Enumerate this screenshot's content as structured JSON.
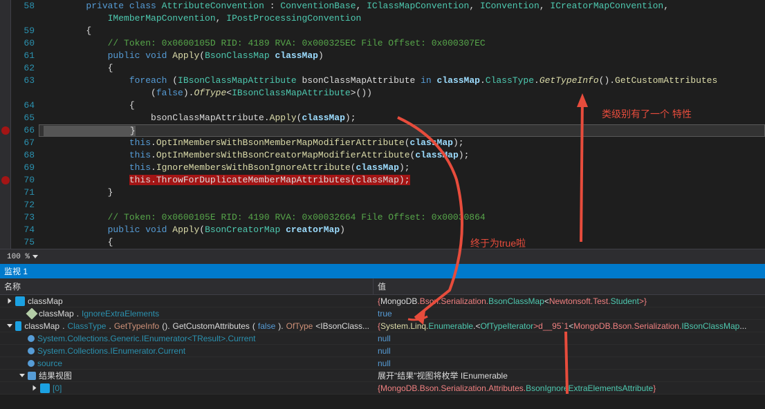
{
  "code": {
    "lines": [
      {
        "num": 58,
        "tokens": [
          {
            "t": "        ",
            "c": ""
          },
          {
            "t": "private class",
            "c": "kw"
          },
          {
            "t": " ",
            "c": ""
          },
          {
            "t": "AttributeConvention",
            "c": "type"
          },
          {
            "t": " : ",
            "c": ""
          },
          {
            "t": "ConventionBase",
            "c": "type"
          },
          {
            "t": ", ",
            "c": ""
          },
          {
            "t": "IClassMapConvention",
            "c": "type"
          },
          {
            "t": ", ",
            "c": ""
          },
          {
            "t": "IConvention",
            "c": "type"
          },
          {
            "t": ", ",
            "c": ""
          },
          {
            "t": "ICreatorMapConvention",
            "c": "type"
          },
          {
            "t": ",",
            "c": ""
          }
        ]
      },
      {
        "num": null,
        "tokens": [
          {
            "t": "            ",
            "c": ""
          },
          {
            "t": "IMemberMapConvention",
            "c": "type"
          },
          {
            "t": ", ",
            "c": ""
          },
          {
            "t": "IPostProcessingConvention",
            "c": "type"
          }
        ]
      },
      {
        "num": 59,
        "tokens": [
          {
            "t": "        {",
            "c": ""
          }
        ]
      },
      {
        "num": 60,
        "tokens": [
          {
            "t": "            ",
            "c": ""
          },
          {
            "t": "// Token: 0x0600105D RID: 4189 RVA: 0x000325EC File Offset: 0x000307EC",
            "c": "comment"
          }
        ]
      },
      {
        "num": 61,
        "tokens": [
          {
            "t": "            ",
            "c": ""
          },
          {
            "t": "public void",
            "c": "kw"
          },
          {
            "t": " ",
            "c": ""
          },
          {
            "t": "Apply",
            "c": "method"
          },
          {
            "t": "(",
            "c": ""
          },
          {
            "t": "BsonClassMap",
            "c": "type"
          },
          {
            "t": " ",
            "c": ""
          },
          {
            "t": "classMap",
            "c": "param"
          },
          {
            "t": ")",
            "c": ""
          }
        ]
      },
      {
        "num": 62,
        "tokens": [
          {
            "t": "            {",
            "c": ""
          }
        ]
      },
      {
        "num": 63,
        "tokens": [
          {
            "t": "                ",
            "c": ""
          },
          {
            "t": "foreach",
            "c": "kw"
          },
          {
            "t": " (",
            "c": ""
          },
          {
            "t": "IBsonClassMapAttribute",
            "c": "type"
          },
          {
            "t": " bsonClassMapAttribute ",
            "c": ""
          },
          {
            "t": "in",
            "c": "kw"
          },
          {
            "t": " ",
            "c": ""
          },
          {
            "t": "classMap",
            "c": "param"
          },
          {
            "t": ".",
            "c": ""
          },
          {
            "t": "ClassType",
            "c": "type"
          },
          {
            "t": ".",
            "c": ""
          },
          {
            "t": "GetTypeInfo",
            "c": "method-it"
          },
          {
            "t": "().",
            "c": ""
          },
          {
            "t": "GetCustomAttributes",
            "c": "method"
          }
        ]
      },
      {
        "num": null,
        "tokens": [
          {
            "t": "                    (",
            "c": ""
          },
          {
            "t": "false",
            "c": "kw"
          },
          {
            "t": ").",
            "c": ""
          },
          {
            "t": "OfType",
            "c": "method-it"
          },
          {
            "t": "<",
            "c": ""
          },
          {
            "t": "IBsonClassMapAttribute",
            "c": "type"
          },
          {
            "t": ">())",
            "c": ""
          }
        ]
      },
      {
        "num": 64,
        "tokens": [
          {
            "t": "                {",
            "c": ""
          }
        ]
      },
      {
        "num": 65,
        "tokens": [
          {
            "t": "                    bsonClassMapAttribute.",
            "c": ""
          },
          {
            "t": "Apply",
            "c": "method"
          },
          {
            "t": "(",
            "c": ""
          },
          {
            "t": "classMap",
            "c": "param"
          },
          {
            "t": ");",
            "c": ""
          }
        ]
      },
      {
        "num": 66,
        "bp": true,
        "current": true,
        "tokens": [
          {
            "t": "                }",
            "c": "highlight-cur"
          }
        ]
      },
      {
        "num": 67,
        "tokens": [
          {
            "t": "                ",
            "c": ""
          },
          {
            "t": "this",
            "c": "this"
          },
          {
            "t": ".",
            "c": ""
          },
          {
            "t": "OptInMembersWithBsonMemberMapModifierAttribute",
            "c": "method"
          },
          {
            "t": "(",
            "c": ""
          },
          {
            "t": "cl",
            "c": "param"
          },
          {
            "t": "a",
            "c": "param"
          },
          {
            "t": "ssMap",
            "c": "param"
          },
          {
            "t": ");",
            "c": ""
          }
        ]
      },
      {
        "num": 68,
        "tokens": [
          {
            "t": "                ",
            "c": ""
          },
          {
            "t": "this",
            "c": "this"
          },
          {
            "t": ".",
            "c": ""
          },
          {
            "t": "OptInMembersWithBsonCreatorMapModifierAttribute",
            "c": "method"
          },
          {
            "t": "(",
            "c": ""
          },
          {
            "t": "cl",
            "c": "param"
          },
          {
            "t": "a",
            "c": "param"
          },
          {
            "t": "ssMap",
            "c": "param"
          },
          {
            "t": ");",
            "c": ""
          }
        ]
      },
      {
        "num": 69,
        "tokens": [
          {
            "t": "                ",
            "c": ""
          },
          {
            "t": "this",
            "c": "this"
          },
          {
            "t": ".",
            "c": ""
          },
          {
            "t": "IgnoreMembersWithBsonIgnoreAttribute",
            "c": "method"
          },
          {
            "t": "(",
            "c": ""
          },
          {
            "t": "classMap",
            "c": "param"
          },
          {
            "t": ");",
            "c": ""
          }
        ]
      },
      {
        "num": 70,
        "bp": true,
        "tokens": [
          {
            "t": "                ",
            "c": ""
          },
          {
            "t": "this.ThrowForDuplicateMemberMapAttributes(classMap);",
            "c": "highlight-err"
          }
        ]
      },
      {
        "num": 71,
        "tokens": [
          {
            "t": "            }",
            "c": ""
          }
        ]
      },
      {
        "num": 72,
        "tokens": [
          {
            "t": "",
            "c": ""
          }
        ]
      },
      {
        "num": 73,
        "tokens": [
          {
            "t": "            ",
            "c": ""
          },
          {
            "t": "// Token: 0x0600105E RID: 4190 RVA: 0x00032664 File Offset: 0x00030864",
            "c": "comment"
          }
        ]
      },
      {
        "num": 74,
        "tokens": [
          {
            "t": "            ",
            "c": ""
          },
          {
            "t": "public void",
            "c": "kw"
          },
          {
            "t": " ",
            "c": ""
          },
          {
            "t": "Apply",
            "c": "method"
          },
          {
            "t": "(",
            "c": ""
          },
          {
            "t": "BsonCreatorMap",
            "c": "type"
          },
          {
            "t": " ",
            "c": ""
          },
          {
            "t": "creatorMap",
            "c": "param"
          },
          {
            "t": ")",
            "c": ""
          }
        ]
      },
      {
        "num": 75,
        "tokens": [
          {
            "t": "            {",
            "c": ""
          }
        ]
      }
    ]
  },
  "zoom": "100 %",
  "watch": {
    "title": "监视 1",
    "headers": {
      "name": "名称",
      "value": "值"
    },
    "rows": [
      {
        "indent": 0,
        "expand": "closed",
        "icon": "var",
        "name_parts": [
          {
            "t": "classMap",
            "c": "t-white"
          }
        ],
        "value_parts": [
          {
            "t": "{",
            "c": "t-red"
          },
          {
            "t": "MongoDB",
            "c": "t-white"
          },
          {
            "t": ".Bson.Serialization.",
            "c": "t-red"
          },
          {
            "t": "BsonClassMap",
            "c": "t-cyan"
          },
          {
            "t": "<",
            "c": "t-white"
          },
          {
            "t": "Newtonsoft.Test.",
            "c": "t-red"
          },
          {
            "t": "Student",
            "c": "t-cyan"
          },
          {
            "t": ">}",
            "c": "t-red"
          }
        ]
      },
      {
        "indent": 1,
        "expand": "none",
        "icon": "prop",
        "name_parts": [
          {
            "t": "classMap",
            "c": "t-white"
          },
          {
            "t": ".",
            "c": "t-white"
          },
          {
            "t": "IgnoreExtraElements",
            "c": "t-teal"
          }
        ],
        "value_parts": [
          {
            "t": "true",
            "c": "t-blue"
          }
        ]
      },
      {
        "indent": 0,
        "expand": "open",
        "icon": "var",
        "name_parts": [
          {
            "t": "classMap",
            "c": "t-white"
          },
          {
            "t": ".",
            "c": "t-white"
          },
          {
            "t": "ClassType",
            "c": "t-teal"
          },
          {
            "t": ".",
            "c": "t-white"
          },
          {
            "t": "GetTypeInfo",
            "c": "t-orange"
          },
          {
            "t": "().",
            "c": "t-white"
          },
          {
            "t": "GetCustomAttributes",
            "c": "t-white"
          },
          {
            "t": "(",
            "c": "t-white"
          },
          {
            "t": "false",
            "c": "t-blue"
          },
          {
            "t": ").",
            "c": "t-white"
          },
          {
            "t": "OfType",
            "c": "t-orange"
          },
          {
            "t": "<IBsonClass...",
            "c": "t-white"
          }
        ],
        "value_parts": [
          {
            "t": "{",
            "c": "t-red"
          },
          {
            "t": "System.Linq.",
            "c": "t-yellow"
          },
          {
            "t": "Enumerable",
            "c": "t-cyan"
          },
          {
            "t": ".<",
            "c": "t-white"
          },
          {
            "t": "OfTypeIterator",
            "c": "t-cyan"
          },
          {
            "t": ">d__95`1",
            "c": "t-red"
          },
          {
            "t": "<",
            "c": "t-white"
          },
          {
            "t": "MongoDB.Bson.Serialization.",
            "c": "t-red"
          },
          {
            "t": "IBsonClassMap",
            "c": "t-cyan"
          },
          {
            "t": "...",
            "c": "t-white"
          }
        ]
      },
      {
        "indent": 1,
        "expand": "none",
        "icon": "field",
        "name_parts": [
          {
            "t": "System.Collections.Generic.IEnumerator<TResult>.Current",
            "c": "t-teal"
          }
        ],
        "value_parts": [
          {
            "t": "null",
            "c": "t-blue"
          }
        ]
      },
      {
        "indent": 1,
        "expand": "none",
        "icon": "field",
        "name_parts": [
          {
            "t": "System.Collections.IEnumerator.Current",
            "c": "t-teal"
          }
        ],
        "value_parts": [
          {
            "t": "null",
            "c": "t-blue"
          }
        ]
      },
      {
        "indent": 1,
        "expand": "none",
        "icon": "field",
        "name_parts": [
          {
            "t": "source",
            "c": "t-teal"
          }
        ],
        "value_parts": [
          {
            "t": "null",
            "c": "t-blue"
          }
        ]
      },
      {
        "indent": 1,
        "expand": "open",
        "icon": "results",
        "name_parts": [
          {
            "t": "结果视图",
            "c": "t-white"
          }
        ],
        "value_parts": [
          {
            "t": "展开\"结果\"视图将枚举 IEnumerable",
            "c": "t-white"
          }
        ]
      },
      {
        "indent": 2,
        "expand": "closed",
        "icon": "var",
        "name_parts": [
          {
            "t": "[0]",
            "c": "t-teal"
          }
        ],
        "value_parts": [
          {
            "t": "{",
            "c": "t-red"
          },
          {
            "t": "MongoDB.Bson.Serialization.Attributes.",
            "c": "t-red"
          },
          {
            "t": "BsonIgnoreExtraElementsAttribute",
            "c": "t-cyan"
          },
          {
            "t": "}",
            "c": "t-red"
          }
        ]
      }
    ]
  },
  "annotations": {
    "a1": "类级别有了一个 特性",
    "a2": "终于为true啦"
  }
}
